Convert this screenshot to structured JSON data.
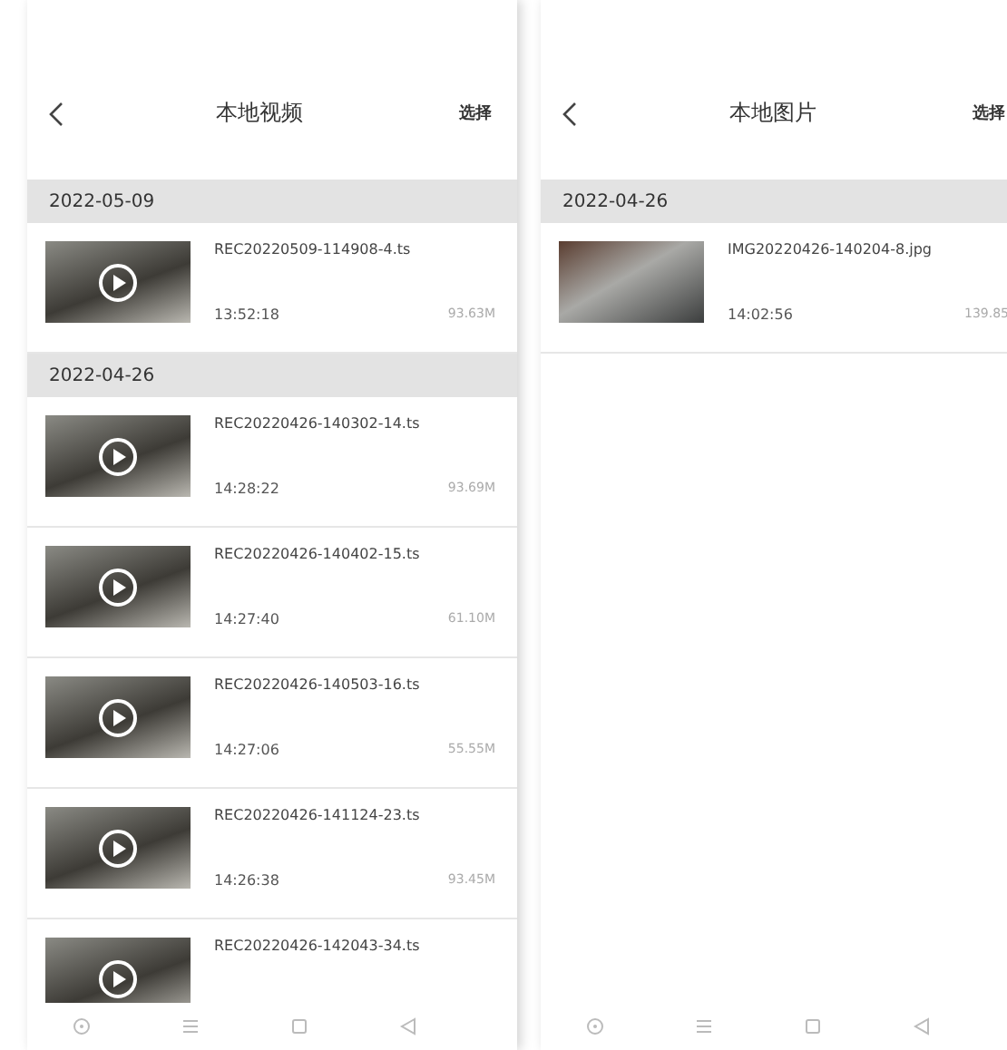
{
  "screens": [
    {
      "title": "本地视频",
      "action": "选择",
      "sections": [
        {
          "date": "2022-05-09",
          "items": [
            {
              "kind": "video",
              "name": "REC20220509-114908-4.ts",
              "time": "13:52:18",
              "size": "93.63M"
            }
          ]
        },
        {
          "date": "2022-04-26",
          "items": [
            {
              "kind": "video",
              "name": "REC20220426-140302-14.ts",
              "time": "14:28:22",
              "size": "93.69M"
            },
            {
              "kind": "video",
              "name": "REC20220426-140402-15.ts",
              "time": "14:27:40",
              "size": "61.10M"
            },
            {
              "kind": "video",
              "name": "REC20220426-140503-16.ts",
              "time": "14:27:06",
              "size": "55.55M"
            },
            {
              "kind": "video",
              "name": "REC20220426-141124-23.ts",
              "time": "14:26:38",
              "size": "93.45M"
            },
            {
              "kind": "video",
              "name": "REC20220426-142043-34.ts"
            }
          ]
        }
      ]
    },
    {
      "title": "本地图片",
      "action": "选择",
      "sections": [
        {
          "date": "2022-04-26",
          "items": [
            {
              "kind": "image",
              "name": "IMG20220426-140204-8.jpg",
              "time": "14:02:56",
              "size": "139.85"
            }
          ]
        }
      ]
    }
  ]
}
